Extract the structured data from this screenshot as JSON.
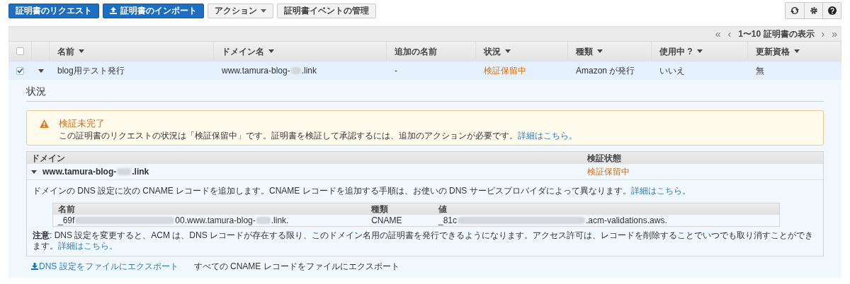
{
  "toolbar": {
    "buttons": [
      {
        "label": "証明書のリクエスト",
        "kind": "primary"
      },
      {
        "label": "証明書のインポート",
        "kind": "upload"
      },
      {
        "label": "アクション",
        "kind": "dropdown"
      },
      {
        "label": "証明書イベントの管理",
        "kind": "default"
      }
    ]
  },
  "pagination": {
    "first": "«",
    "previous": "‹",
    "label": "1〜10 証明書の表示",
    "next": "›",
    "last": "»"
  },
  "table": {
    "header_checked": false,
    "columns": [
      {
        "label": "名前",
        "sortable": true
      },
      {
        "label": "ドメイン名",
        "sortable": true
      },
      {
        "label": "追加の名前",
        "sortable": false
      },
      {
        "label": "状況",
        "sortable": true
      },
      {
        "label": "種類",
        "sortable": true
      },
      {
        "label": "使用中 ?",
        "sortable": true
      },
      {
        "label": "更新資格",
        "sortable": true
      }
    ],
    "rows": [
      {
        "checked": true,
        "expanded": true,
        "name": "blog用テスト発行",
        "domain_parts": [
          "www.tamura-blog-",
          ".link"
        ],
        "additional_names": "-",
        "status": "検証保留中",
        "type": "Amazon が発行",
        "in_use": "いいえ",
        "renewal": "無"
      }
    ]
  },
  "details": {
    "heading": "状況",
    "alert": {
      "title": "検証未完了",
      "message": "この証明書のリクエストの状況は「検証保留中」です。証明書を検証して承認するには、追加のアクションが必要です。",
      "link": "詳細はこちら。"
    },
    "domain_table": {
      "columns": [
        "ドメイン",
        "検証状態"
      ],
      "rows": [
        {
          "expanded": true,
          "domain_parts": [
            "www.tamura-blog-",
            ".link"
          ],
          "status": "検証保留中",
          "instructions": "ドメインの DNS 設定に次の CNAME レコードを追加します。CNAME レコードを追加する手順は、お使いの DNS サービスプロバイダによって異なります。",
          "instructions_link": "詳細はこちら。",
          "record": {
            "columns": [
              "名前",
              "種類",
              "値"
            ],
            "name_parts": [
              "_69f",
              "00.www.tamura-blog-",
              ".link."
            ],
            "type": "CNAME",
            "value_parts": [
              "_81c",
              ".acm-validations.aws."
            ]
          },
          "note": "**注意**: DNS 設定を変更すると、ACM は、DNS レコードが存在する限り、このドメイン名用の証明書を発行できるようになります。アクセス許可は、レコードを削除することでいつでも取り消すことができます。",
          "note_link": "詳細はこちら。"
        }
      ]
    }
  },
  "exports": [
    {
      "label": "DNS 設定をファイルにエクスポート",
      "kind": "link"
    },
    {
      "label": "すべての CNAME レコードをファイルにエクスポート",
      "kind": "text"
    }
  ]
}
